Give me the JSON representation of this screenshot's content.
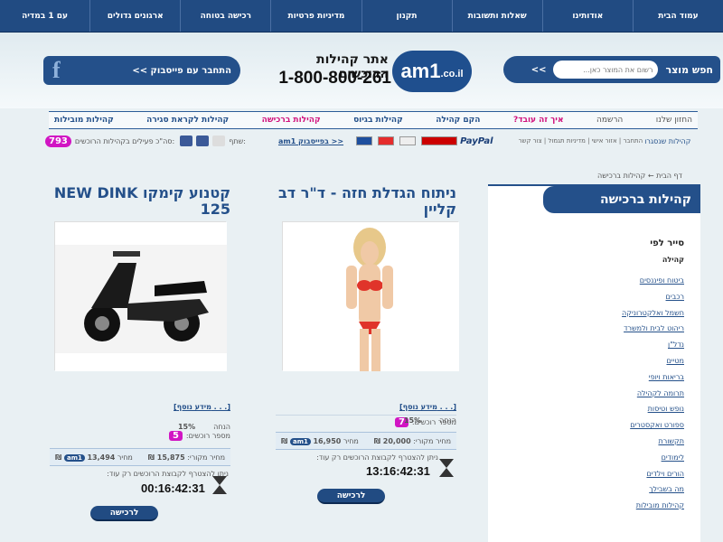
{
  "topnav": [
    "עמוד הבית",
    "אודותינו",
    "שאלות ותשובות",
    "תקנון",
    "מדיניות פרטיות",
    "רכישה בטוחה",
    "ארגונים גדולים",
    "עם 1 במדיה"
  ],
  "search": {
    "label": "חפש מוצר",
    "placeholder": "רשום את המוצר כאן...",
    "go": ">>"
  },
  "logo": {
    "main": "am1",
    "suffix": ".co.il"
  },
  "tagline": "אתר קהילות הרוכשים",
  "phone": "1-800-800-261",
  "facebook": {
    "text": "התחבר עם פייסבוק >>",
    "icon": "f"
  },
  "catnav": [
    {
      "label": "החזון שלנו",
      "style": "plain"
    },
    {
      "label": "הרשמה",
      "style": "plain"
    },
    {
      "label": "איך זה עובד?",
      "style": "pink"
    },
    {
      "label": "הקם קהילה",
      "style": "blue"
    },
    {
      "label": "קהילות בגיוס",
      "style": "blue"
    },
    {
      "label": "קהילות ברכישה",
      "style": "pink"
    },
    {
      "label": "קהילות לקראת סגירה",
      "style": "blue"
    },
    {
      "label": "קהילות מובילות",
      "style": "blue"
    }
  ],
  "bar2": {
    "links": "התחבר | אזור אישי | מדיניות תגמול | צור קשר",
    "fb_link": "am1 בפייסבוק >>",
    "paypal": "PayPal",
    "share": "שתף:",
    "active_label": "סה\"כ פעילים בקהילות הרוכשים:",
    "active_count": "793",
    "joined_label": "קהילות שנסגרו"
  },
  "breadcrumb": "דף הבית ← קהילות ברכישה",
  "sidebar": {
    "title": "קהילות ברכישה",
    "sort_by": "סייר לפי",
    "group": "קהילה",
    "items": [
      "ביטוח ופיננסים",
      "רכבים",
      "חשמל ואלקטרוניקה",
      "ריהוט לבית ולמשרד",
      "נדל\"ן",
      "מטיים",
      "בריאות ויופי",
      "תרומה לקהילה",
      "נופש וטיסות",
      "ספורט ואקסטרים",
      "תקשורת",
      "לימודים",
      "הורים וילדים",
      "מה בשבילך",
      "קהילות מובילות"
    ]
  },
  "products": [
    {
      "title": "ניתוח הגדלת חזה - ד\"ר דב קליין",
      "more": "[מידע נוסף . . .]",
      "buyers_label": "מספר רוכשים:",
      "buyers": "7",
      "discount_label": "הנחה",
      "discount": "15%",
      "orig_label": "מחיר מקורי:",
      "orig": "20,000 ₪",
      "price_label": "מחיר",
      "price": "16,950 ₪",
      "until": "ניתן להצטרף לקבוצת הרוכשים רק עוד:",
      "timer": "13:16:42:31",
      "buy": "לרכישה"
    },
    {
      "title": "קטנוע קימקו NEW DINK 125",
      "more": "[מידע נוסף . . .]",
      "buyers_label": "מספר רוכשים:",
      "buyers": "5",
      "discount_label": "הנחה",
      "discount": "15%",
      "orig_label": "מחיר מקורי:",
      "orig": "15,875 ₪",
      "price_label": "מחיר",
      "price": "13,494 ₪",
      "until": "ניתן להצטרף לקבוצת הרוכשים רק עוד:",
      "timer": "00:16:42:31",
      "buy": "לרכישה"
    }
  ],
  "colors": {
    "primary": "#214b82",
    "pink": "#d115c3",
    "link": "#24508a"
  }
}
